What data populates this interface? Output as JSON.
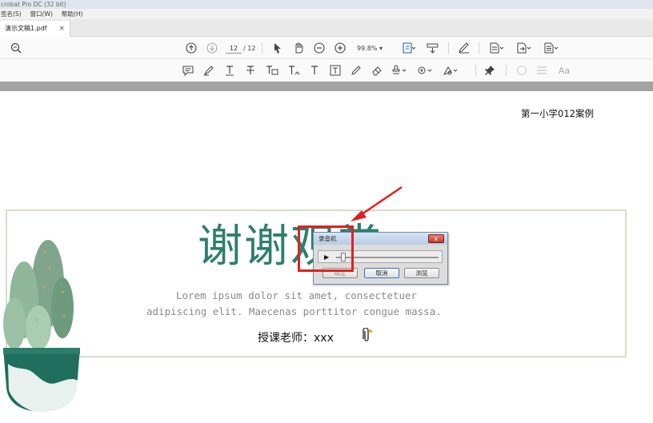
{
  "window": {
    "title": "crobat Pro DC (32 bit)"
  },
  "menu": {
    "items": [
      "签名(S)",
      "窗口(W)",
      "帮助(H)"
    ]
  },
  "tab": {
    "label": "演示文稿1.pdf",
    "close": "×"
  },
  "toolbar": {
    "page_current": "12",
    "page_total": "/ 12",
    "zoom": "99.8%",
    "dropdown_caret": "▾",
    "zoom_caret": "▾"
  },
  "toolbar2": {
    "font_label": "Aa"
  },
  "document": {
    "header_note": "第一小学012案例",
    "thanks_text": "谢谢观赏",
    "lorem_line1": "Lorem ipsum dolor sit amet, consectetuer",
    "lorem_line2": "adipiscing elit. Maecenas porttitor congue massa.",
    "teacher": "授课老师：xxx"
  },
  "recorder": {
    "title": "录音机",
    "close": "x",
    "play": "▶",
    "progress": 0.05,
    "ok_label": "确定",
    "cancel_label": "取消",
    "browse_label": "浏览"
  },
  "colors": {
    "title_green": "#2e7f6e",
    "highlight_red": "#e02020"
  }
}
